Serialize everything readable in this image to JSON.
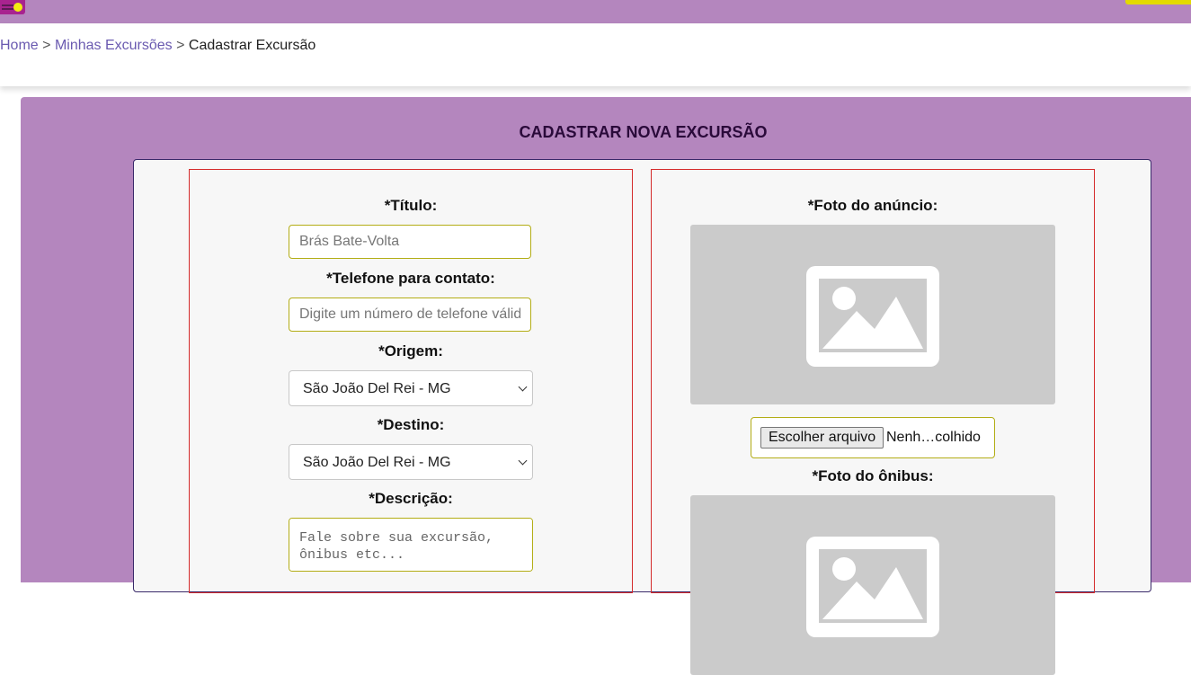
{
  "breadcrumb": {
    "home": "Home",
    "sep1": ">",
    "my_excursions": "Minhas Excursões",
    "sep2": ">",
    "current": "Cadastrar Excursão"
  },
  "page_title": "CADASTRAR NOVA EXCURSÃO",
  "form": {
    "title_label": "*Título:",
    "title_placeholder": "Brás Bate-Volta",
    "phone_label": "*Telefone para contato:",
    "phone_placeholder": "Digite um número de telefone válido",
    "origin_label": "*Origem:",
    "origin_value": "São João Del Rei - MG",
    "destination_label": "*Destino:",
    "destination_value": "São João Del Rei - MG",
    "description_label": "*Descrição:",
    "description_placeholder": "Fale sobre sua excursão, ônibus etc..."
  },
  "photos": {
    "ad_photo_label": "*Foto do anúncio:",
    "choose_file_label": "Escolher arquivo",
    "no_file_text": "Nenh…colhido",
    "bus_photo_label": "*Foto do ônibus:"
  },
  "icons": {
    "logo": "logo-icon",
    "image_placeholder": "image-icon",
    "chevron": "chevron-down-icon"
  },
  "colors": {
    "brand_purple": "#b486be",
    "accent_yellow": "#e3da00",
    "field_border": "#b3ad16",
    "column_border": "#d42b2b"
  }
}
